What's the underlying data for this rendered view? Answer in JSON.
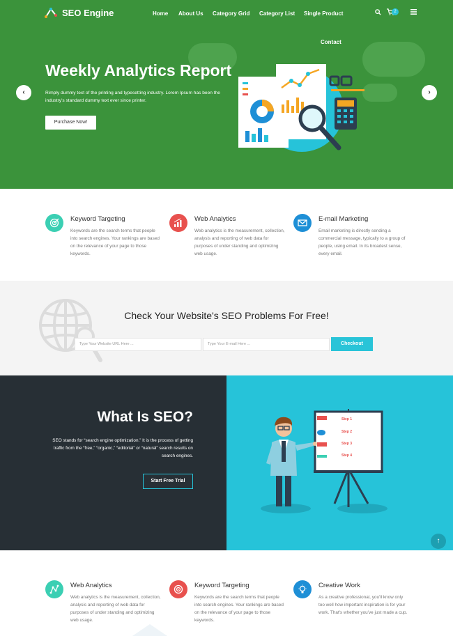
{
  "brand": {
    "name": "SEO Engine",
    "accent": "#3b933b",
    "cyan": "#26c3d9"
  },
  "nav": {
    "items": [
      "Home",
      "About Us",
      "Category Grid",
      "Category List",
      "Single Product",
      "Contact"
    ],
    "cart_count": "2",
    "icons": [
      "search-icon",
      "cart-icon",
      "menu-icon"
    ]
  },
  "hero": {
    "title": "Weekly Analytics Report",
    "text": "Rimply dummy text of the printing and typesetting industry. Lorem Ipsum has been the industry's standard dummy text ever since printer.",
    "button": "Purchase Now!",
    "prev": "‹",
    "next": "›"
  },
  "features_top": [
    {
      "title": "Keyword Targeting",
      "text": "Keywords are the search terms that people into search engines. Your rankings are based on the relevance of your page to those keywords.",
      "icon": "target-icon",
      "color": "#3bcfb3"
    },
    {
      "title": "Web Analytics",
      "text": "Web analytics is the measurement, collection, analysis and reporting of web data for purposes of under standing and optimizing web usage.",
      "icon": "bar-chart-icon",
      "color": "#e8514e"
    },
    {
      "title": "E-mail Marketing",
      "text": "Email marketing is directly sending a commercial message, typically to a group of people, using email. In its broadest sense, every email.",
      "icon": "envelope-icon",
      "color": "#1e8fd6"
    }
  ],
  "seo_check": {
    "title": "Check Your Website's SEO Problems For Free!",
    "url_placeholder": "Type Your Website URL Here ...",
    "email_placeholder": "Type Your E-mail  Here ...",
    "button": "Checkout"
  },
  "what_is_seo": {
    "title": "What Is SEO?",
    "text": "SEO stands for “search engine optimization.” It is the process of getting traffic from the “free,” “organic,” “editorial” or “natural” search results on search engines.",
    "button": "Start Free Trial",
    "board_steps": [
      "Step 1",
      "Step 2",
      "Step 3",
      "Step 4"
    ]
  },
  "features_bottom": [
    {
      "title": "Web Analytics",
      "text": "Web analytics is the measurement, collection, analysis and reporting of web data for purposes of under standing and optimizing web usage.",
      "icon": "network-icon",
      "color": "#3bcfb3"
    },
    {
      "title": "Keyword Targeting",
      "text": "Keywords are the search terms that people into search engines. Your rankings are based on the relevance of your page to those keywords.",
      "icon": "target-icon",
      "color": "#e8514e"
    },
    {
      "title": "Creative Work",
      "text": "As a creative professional, you'll know only too well how important inspiration is for your work. That's whether you've just made a cup.",
      "icon": "lightbulb-icon",
      "color": "#1e8fd6"
    }
  ],
  "back_to_top": "↑"
}
